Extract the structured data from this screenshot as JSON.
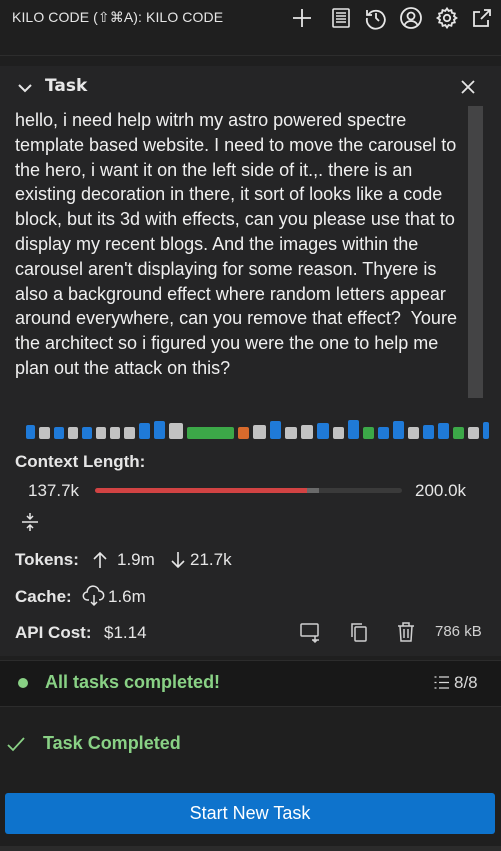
{
  "app": {
    "title": "KILO CODE (⇧⌘A): KILO CODE",
    "toolbar_icons": [
      "plus-icon",
      "history-list-icon",
      "history-icon",
      "account-icon",
      "gear-icon",
      "popout-icon"
    ]
  },
  "task": {
    "header": "Task",
    "text": "hello, i need help witrh my astro powered spectre template based website. I need to move the carousel to the hero, i want it on the left side of it.,. there is an existing decoration in there, it sort of looks like a code block, but its 3d with effects, can you please use that to display my recent blogs. And the images within the carousel aren't displaying for some reason. Thyere is also a background effect where random letters appear around everywhere, can you remove that effect?  Youre the architect so i figured you were the one to help me plan out the attack on this?"
  },
  "context": {
    "label": "Context Length:",
    "used": "137.7k",
    "max": "200.0k",
    "used_fraction": 0.69,
    "reserved_fraction": 0.04
  },
  "tokens": {
    "label": "Tokens:",
    "up": "1.9m",
    "down": "21.7k"
  },
  "cache": {
    "label": "Cache:",
    "value": "1.6m"
  },
  "cost": {
    "label": "API Cost:",
    "value": "$1.14",
    "size": "786 kB"
  },
  "todos": {
    "status": "All tasks completed!",
    "count": "8/8"
  },
  "completion": {
    "label": "Task Completed"
  },
  "actions": {
    "start_new_task": "Start New Task"
  },
  "colors": {
    "accent": "#0e73cc",
    "success": "#89d185",
    "context_fill": "#d24343",
    "block_blue": "#1f7ad8",
    "block_gray": "#c2c2c2",
    "block_green": "#3ca848",
    "block_orange": "#d86a2c"
  }
}
